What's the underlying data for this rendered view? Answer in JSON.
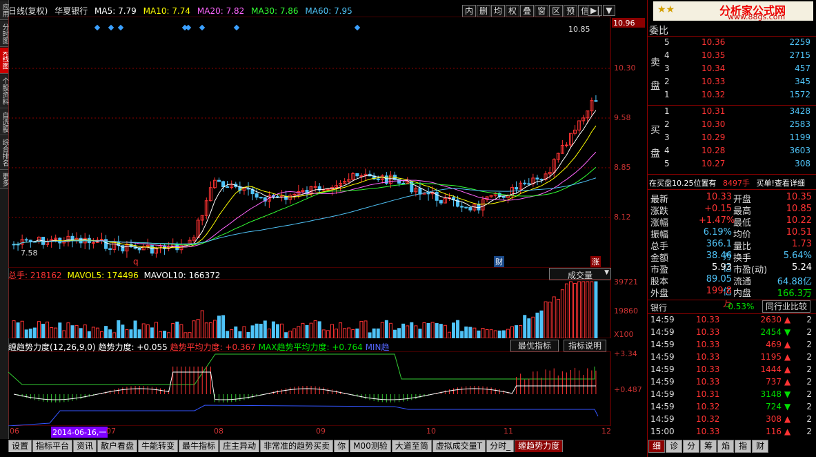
{
  "header": {
    "period": "日线(复权)",
    "stock": "华夏银行",
    "ma5": "MA5: 7.79",
    "ma10": "MA10: 7.74",
    "ma20": "MA20: 7.82",
    "ma30": "MA30: 7.86",
    "ma60": "MA60: 7.95"
  },
  "toolbar": [
    "内",
    "删",
    "均",
    "权",
    "叠",
    "窗",
    "区",
    "预",
    "信息"
  ],
  "left_tabs": [
    "应用",
    "分时图",
    "K线图",
    "个股资料",
    "自选股",
    "综合排名",
    "更多"
  ],
  "price_axis": {
    "labels": [
      "10.96",
      "10.30",
      "9.58",
      "8.85",
      "8.12"
    ],
    "top_mark": "10.85",
    "low_mark": "7.58"
  },
  "price_markers": {
    "q": "q",
    "cai": "财",
    "zhang": "涨"
  },
  "volume": {
    "label_total": "总手:",
    "total": "218162",
    "mavol5": "MAVOL5: 174496",
    "mavol10": "MAVOL10: 166372",
    "select": "成交量",
    "axis": [
      "39721",
      "19860",
      "X100"
    ]
  },
  "indicator": {
    "name": "缠趋势力度(12,26,9,0)",
    "v1": "趋势力度: +0.055",
    "v2": "趋势平均力度: +0.367",
    "v3": "MAX趋势平均力度: +0.764",
    "v4": "MIN趋",
    "btn1": "最优指标",
    "btn2": "指标说明",
    "axis": [
      "+3.34",
      "+0.487"
    ]
  },
  "date_axis": [
    "06",
    "2014-06-16,一",
    "07",
    "08",
    "09",
    "10",
    "11",
    "12"
  ],
  "bottom_tabs": [
    "设置",
    "指标平台",
    "资讯",
    "散户看盘",
    "牛能转变",
    "最牛指标",
    "庄主异动",
    "非常准的趋势买卖",
    "你",
    "M00测验",
    "大道至简",
    "虚拟成交量T",
    "分时_",
    "缠趋势力度"
  ],
  "right_tabs": [
    "细",
    "诊",
    "分",
    "筹",
    "焰",
    "指",
    "财"
  ],
  "watermark": {
    "line1": "分析家公式网",
    "line2": "www.88gs.com"
  },
  "orderbook": {
    "title": "委比",
    "sell_label": "卖盘",
    "buy_label": "买盘",
    "sell": [
      {
        "lv": "5",
        "price": "10.36",
        "vol": "2259"
      },
      {
        "lv": "4",
        "price": "10.35",
        "vol": "2715"
      },
      {
        "lv": "3",
        "price": "10.34",
        "vol": "457"
      },
      {
        "lv": "2",
        "price": "10.33",
        "vol": "345"
      },
      {
        "lv": "1",
        "price": "10.32",
        "vol": "1572"
      }
    ],
    "buy": [
      {
        "lv": "1",
        "price": "10.31",
        "vol": "3428"
      },
      {
        "lv": "2",
        "price": "10.30",
        "vol": "2583"
      },
      {
        "lv": "3",
        "price": "10.29",
        "vol": "1199"
      },
      {
        "lv": "4",
        "price": "10.28",
        "vol": "3603"
      },
      {
        "lv": "5",
        "price": "10.27",
        "vol": "308"
      }
    ],
    "notice_a": "在买盘10.25位置有",
    "notice_b": "8497手",
    "notice_c": "买单!查看详细"
  },
  "quote": [
    {
      "k": "最新",
      "v1": "10.33",
      "c1": "red",
      "k2": "开盘",
      "v2": "10.35",
      "c2": "red"
    },
    {
      "k": "涨跌",
      "v1": "+0.15",
      "c1": "red",
      "k2": "最高",
      "v2": "10.85",
      "c2": "red"
    },
    {
      "k": "涨幅",
      "v1": "+1.47%",
      "c1": "red",
      "k2": "最低",
      "v2": "10.22",
      "c2": "red"
    },
    {
      "k": "振幅",
      "v1": "6.19%",
      "c1": "cyan",
      "k2": "均价",
      "v2": "10.51",
      "c2": "red"
    },
    {
      "k": "总手",
      "v1": "366.1万",
      "c1": "cyan",
      "k2": "量比",
      "v2": "1.73",
      "c2": "red"
    },
    {
      "k": "金额",
      "v1": "38.46亿",
      "c1": "cyan",
      "k2": "换手",
      "v2": "5.64%",
      "c2": "cyan"
    },
    {
      "k": "市盈",
      "v1": "5.93",
      "c1": "white",
      "k2": "市盈(动)",
      "v2": "5.24",
      "c2": "white"
    },
    {
      "k": "股本",
      "v1": "89.05亿",
      "c1": "cyan",
      "k2": "流通",
      "v2": "64.88亿",
      "c2": "cyan"
    },
    {
      "k": "外盘",
      "v1": "199.8万",
      "c1": "red",
      "k2": "内盘",
      "v2": "166.3万",
      "c2": "green"
    }
  ],
  "industry": {
    "name": "银行",
    "pct": "-0.53%",
    "btn": "同行业比较"
  },
  "ticks": [
    {
      "t": "14:59",
      "p": "10.33",
      "v": "2630",
      "d": "up",
      "c": "2"
    },
    {
      "t": "14:59",
      "p": "10.33",
      "v": "2454",
      "d": "down",
      "c": "2"
    },
    {
      "t": "14:59",
      "p": "10.33",
      "v": "469",
      "d": "up",
      "c": "2"
    },
    {
      "t": "14:59",
      "p": "10.33",
      "v": "1195",
      "d": "up",
      "c": "2"
    },
    {
      "t": "14:59",
      "p": "10.33",
      "v": "1444",
      "d": "up",
      "c": "2"
    },
    {
      "t": "14:59",
      "p": "10.33",
      "v": "737",
      "d": "up",
      "c": "2"
    },
    {
      "t": "14:59",
      "p": "10.31",
      "v": "3148",
      "d": "down",
      "c": "2"
    },
    {
      "t": "14:59",
      "p": "10.32",
      "v": "724",
      "d": "down",
      "c": "2"
    },
    {
      "t": "14:59",
      "p": "10.32",
      "v": "308",
      "d": "up",
      "c": "2"
    },
    {
      "t": "15:00",
      "p": "10.33",
      "v": "116",
      "d": "up",
      "c": "2"
    }
  ]
}
